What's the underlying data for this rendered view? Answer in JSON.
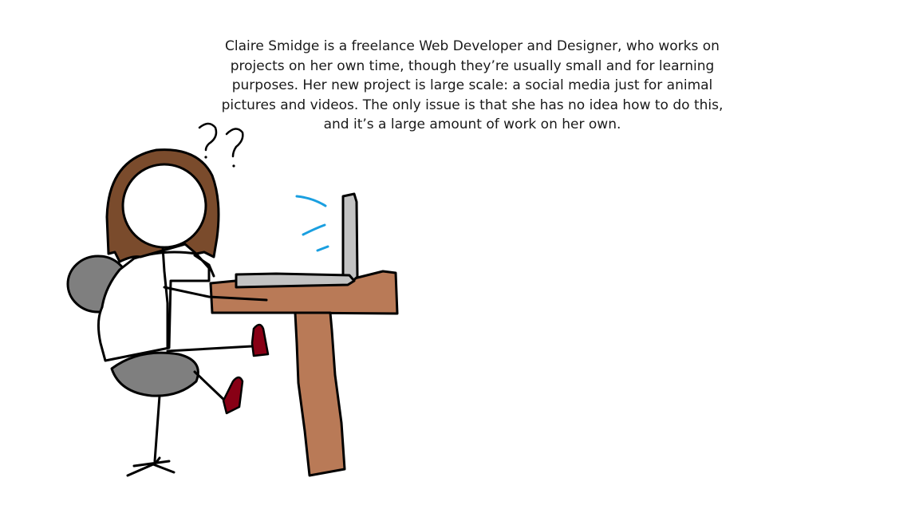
{
  "caption": {
    "lines": [
      "Claire Smidge is a freelance Web Developer and Designer, who works on",
      "projects on her own time, though they’re usually small and for learning",
      "purposes. Her new project is large scale: a social media just for animal",
      "pictures and videos. The only issue is that she has no idea how to do this,",
      "and it’s a large amount of work on her own."
    ]
  },
  "colors": {
    "background": "#ffffff",
    "outline": "#000000",
    "hair": "#7a4b2c",
    "chair": "#7f7f7f",
    "desk": "#b97a57",
    "laptop": "#c3c3c3",
    "shoes": "#880015",
    "screen_glow": "#1a9fe0"
  },
  "illustration": {
    "subject": "stick-figure-woman-at-laptop",
    "symbols": [
      "question-mark",
      "question-mark"
    ]
  }
}
